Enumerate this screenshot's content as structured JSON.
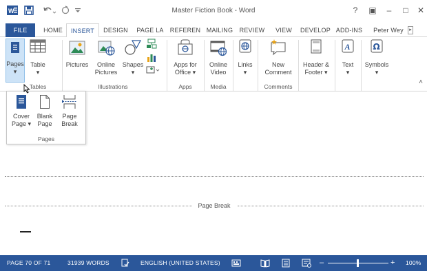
{
  "window": {
    "title": "Master Fiction Book - Word",
    "help": "?",
    "ribbon_display": "▣",
    "minimize": "–",
    "maximize": "□",
    "close": "✕"
  },
  "tabs": [
    {
      "label": "FILE"
    },
    {
      "label": "HOME"
    },
    {
      "label": "INSERT"
    },
    {
      "label": "DESIGN"
    },
    {
      "label": "PAGE LA"
    },
    {
      "label": "REFEREN"
    },
    {
      "label": "MAILING"
    },
    {
      "label": "REVIEW"
    },
    {
      "label": "VIEW"
    },
    {
      "label": "DEVELOP"
    },
    {
      "label": "ADD-INS"
    },
    {
      "label": "Peter Wey"
    }
  ],
  "ribbon": {
    "pages": {
      "label": "Pages",
      "arrow": "▾"
    },
    "table": {
      "label": "Table",
      "arrow": "▾"
    },
    "pictures": {
      "label": "Pictures"
    },
    "online_pictures": {
      "line1": "Online",
      "line2": "Pictures"
    },
    "shapes": {
      "label": "Shapes",
      "arrow": "▾"
    },
    "apps_for_office": {
      "line1": "Apps for",
      "line2": "Office ▾"
    },
    "online_video": {
      "line1": "Online",
      "line2": "Video"
    },
    "links": {
      "label": "Links",
      "arrow": "▾"
    },
    "new_comment": {
      "line1": "New",
      "line2": "Comment"
    },
    "header_footer": {
      "line1": "Header &",
      "line2": "Footer ▾"
    },
    "text": {
      "label": "Text",
      "arrow": "▾"
    },
    "symbols": {
      "label": "Symbols",
      "arrow": "▾"
    },
    "groups": {
      "tables": "Tables",
      "illustrations": "Illustrations",
      "apps": "Apps",
      "media": "Media",
      "comments": "Comments"
    },
    "collapse": "˄"
  },
  "pages_menu": {
    "items": [
      {
        "line1": "Cover",
        "line2": "Page ▾"
      },
      {
        "line1": "Blank",
        "line2": "Page"
      },
      {
        "line1": "Page",
        "line2": "Break"
      }
    ],
    "group_label": "Pages"
  },
  "document": {
    "page_break_label": "Page Break"
  },
  "status": {
    "page": "PAGE 70 OF 71",
    "words": "31939 WORDS",
    "language": "ENGLISH (UNITED STATES)",
    "zoom_minus": "–",
    "zoom_plus": "+",
    "zoom": "100%"
  },
  "colors": {
    "accent": "#2b579a",
    "icon_blue": "#2b579a",
    "icon_green": "#2e8b57",
    "icon_orange": "#e8a317"
  }
}
